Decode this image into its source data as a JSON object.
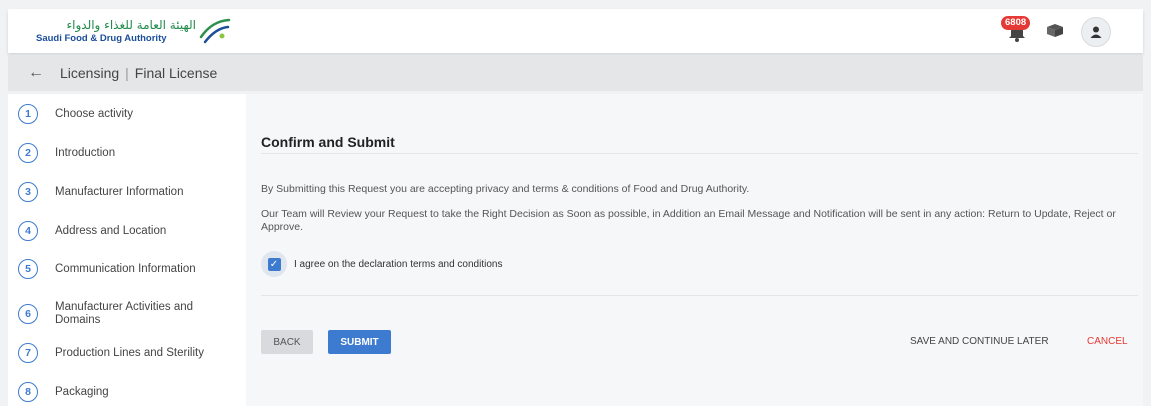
{
  "header": {
    "logo_arabic": "الهيئة العامة للغذاء والدواء",
    "logo_english": "Saudi Food & Drug Authority",
    "notification_count": "6808",
    "icons": [
      "bell-icon",
      "box-icon",
      "user-icon"
    ]
  },
  "breadcrumb": {
    "back_icon": "←",
    "section": "Licensing",
    "separator": "|",
    "page": "Final License"
  },
  "steps": [
    {
      "num": "1",
      "label": "Choose activity"
    },
    {
      "num": "2",
      "label": "Introduction"
    },
    {
      "num": "3",
      "label": "Manufacturer Information"
    },
    {
      "num": "4",
      "label": "Address and Location"
    },
    {
      "num": "5",
      "label": "Communication Information"
    },
    {
      "num": "6",
      "label": "Manufacturer Activities and Domains"
    },
    {
      "num": "7",
      "label": "Production Lines and Sterility"
    },
    {
      "num": "8",
      "label": "Packaging"
    }
  ],
  "main": {
    "title": "Confirm and Submit",
    "paragraph1": "By Submitting this Request you are accepting privacy and terms & conditions of Food and Drug Authority.",
    "paragraph2": "Our Team will Review your Request to take the Right Decision as Soon as possible, in Addition an Email Message and Notification will be sent in any action: Return to Update, Reject or Approve.",
    "agree_label": "I agree on the declaration terms and conditions",
    "agree_checked": true,
    "check_glyph": "✓"
  },
  "actions": {
    "back": "BACK",
    "submit": "SUBMIT",
    "save_later": "SAVE AND CONTINUE LATER",
    "cancel": "CANCEL"
  },
  "colors": {
    "accent": "#3d7bd0",
    "danger": "#e53935",
    "logo_green": "#1f8a4a",
    "logo_blue": "#1c4e9a"
  }
}
